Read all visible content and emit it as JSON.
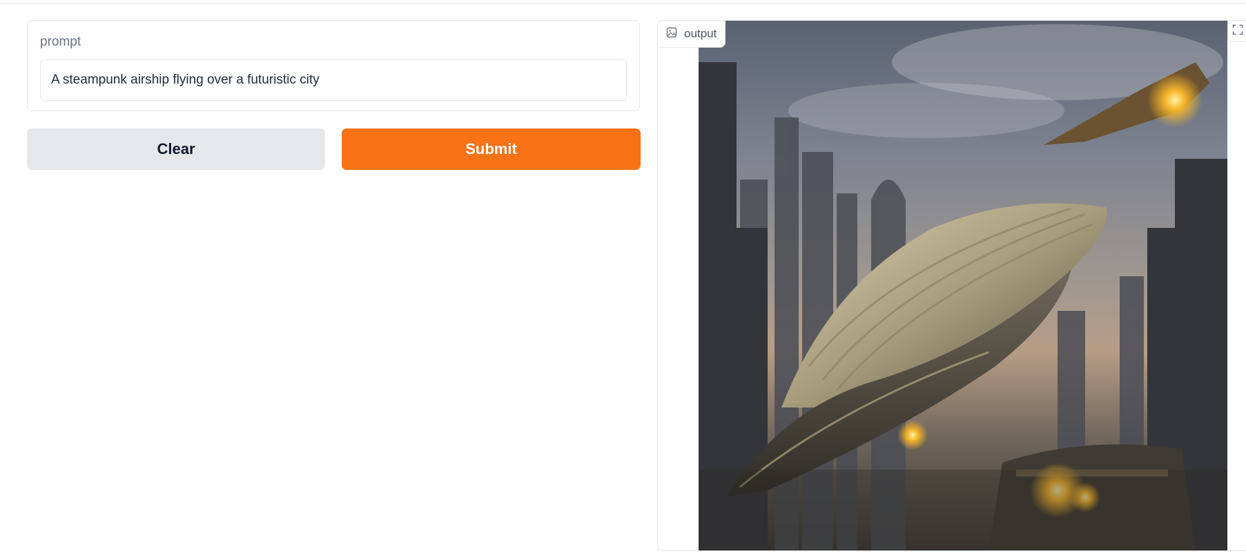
{
  "prompt": {
    "label": "prompt",
    "value": "A steampunk airship flying over a futuristic city"
  },
  "buttons": {
    "clear_label": "Clear",
    "submit_label": "Submit"
  },
  "output": {
    "label": "output",
    "label_icon": "image-icon",
    "fullscreen_icon": "fullscreen-icon",
    "image_subject": "steampunk-airship-over-city"
  },
  "colors": {
    "accent": "#f97316",
    "secondary_button": "#e5e7eb",
    "border": "#e5e7eb"
  }
}
